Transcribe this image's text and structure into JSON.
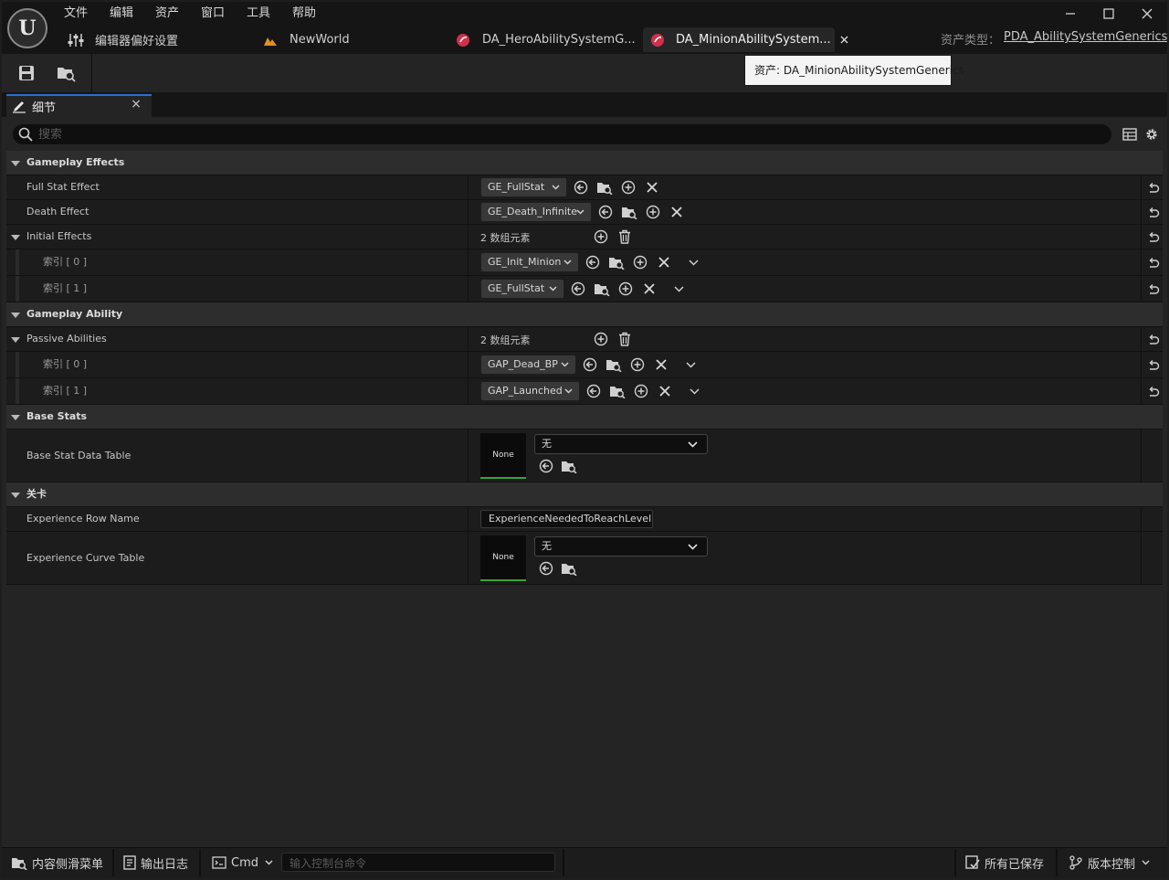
{
  "menu": [
    "文件",
    "编辑",
    "资产",
    "窗口",
    "工具",
    "帮助"
  ],
  "tabs": {
    "editor_prefs": "编辑器偏好设置",
    "new_world": "NewWorld",
    "hero_asset": "DA_HeroAbilitySystemG...",
    "minion_asset": "DA_MinionAbilitySystem..."
  },
  "asset_type": {
    "label": "资产类型：",
    "value": "PDA_AbilitySystemGenerics"
  },
  "tooltip": "资产: DA_MinionAbilitySystemGenerics",
  "details_tab": {
    "label": "细节",
    "close": "×"
  },
  "search": {
    "placeholder": "搜索"
  },
  "sections": {
    "gameplay_effects": {
      "title": "Gameplay Effects",
      "full_stat": {
        "label": "Full Stat Effect",
        "value": "GE_FullStat"
      },
      "death": {
        "label": "Death Effect",
        "value": "GE_Death_Infinite"
      },
      "initial": {
        "label": "Initial Effects",
        "count": "2 数组元素",
        "items": [
          {
            "label": "索引 [ 0 ]",
            "value": "GE_Init_Minion"
          },
          {
            "label": "索引 [ 1 ]",
            "value": "GE_FullStat"
          }
        ]
      }
    },
    "gameplay_ability": {
      "title": "Gameplay Ability",
      "passive": {
        "label": "Passive Abilities",
        "count": "2 数组元素",
        "items": [
          {
            "label": "索引 [ 0 ]",
            "value": "GAP_Dead_BP"
          },
          {
            "label": "索引 [ 1 ]",
            "value": "GAP_Launched"
          }
        ]
      }
    },
    "base_stats": {
      "title": "Base Stats",
      "table": {
        "label": "Base Stat Data Table",
        "thumb": "None",
        "value": "无"
      }
    },
    "level": {
      "title": "关卡",
      "row_name": {
        "label": "Experience Row Name",
        "value": "ExperienceNeededToReachLevel"
      },
      "curve": {
        "label": "Experience Curve Table",
        "thumb": "None",
        "value": "无"
      }
    }
  },
  "statusbar": {
    "content_drawer": "内容侧滑菜单",
    "output_log": "输出日志",
    "cmd": "Cmd",
    "cmd_placeholder": "输入控制台命令",
    "all_saved": "所有已保存",
    "source_control": "版本控制"
  },
  "colors": {
    "accent_blue": "#2a6fd1",
    "thumb_green": "#3aa33a",
    "asset_red": "#d0304a",
    "world_orange": "#e09020"
  }
}
